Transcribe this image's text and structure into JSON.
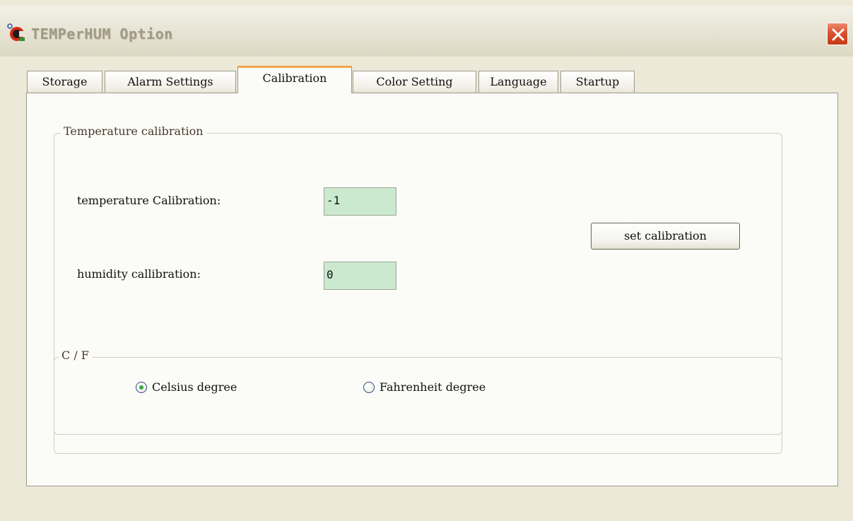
{
  "window": {
    "title": "TEMPerHUM Option",
    "close_label": "×"
  },
  "tabs": [
    {
      "label": "Storage",
      "active": false
    },
    {
      "label": "Alarm Settings",
      "active": false
    },
    {
      "label": "Calibration",
      "active": true
    },
    {
      "label": "Color Setting",
      "active": false
    },
    {
      "label": "Language",
      "active": false
    },
    {
      "label": "Startup",
      "active": false
    }
  ],
  "calibration": {
    "group_title": "Temperature calibration",
    "temperature_label": "temperature Calibration:",
    "temperature_value": "-1",
    "humidity_label": "humidity callibration:",
    "humidity_value": "0",
    "set_button": "set calibration"
  },
  "unit": {
    "group_title": "C / F",
    "options": [
      {
        "label": "Celsius degree",
        "selected": true
      },
      {
        "label": "Fahrenheit degree",
        "selected": false
      }
    ]
  },
  "colors": {
    "field_bg": "#cbe9cf",
    "active_tab_accent": "#f0a64a",
    "close_button": "#d9532e",
    "radio_selected": "#3aa844"
  },
  "icons": {
    "app": "thermometer-app-icon",
    "close": "close-icon"
  }
}
